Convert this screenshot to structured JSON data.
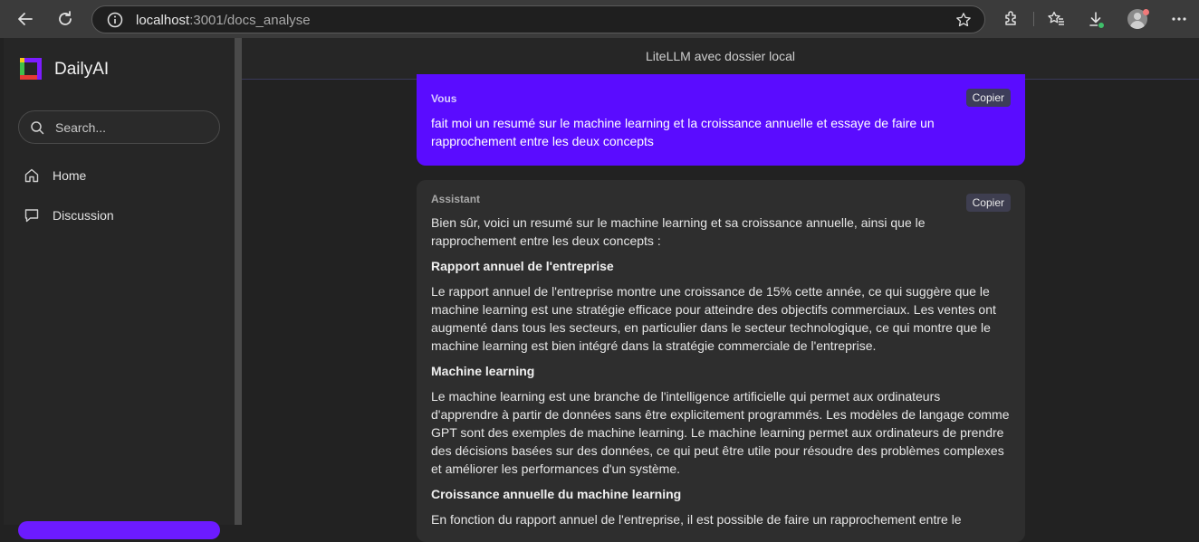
{
  "browser": {
    "url_host": "localhost",
    "url_path": ":3001/docs_analyse"
  },
  "sidebar": {
    "brand": "DailyAI",
    "search_placeholder": "Search...",
    "items": [
      {
        "label": "Home",
        "icon": "home-icon"
      },
      {
        "label": "Discussion",
        "icon": "chat-bubble-icon"
      }
    ]
  },
  "main": {
    "header_title": "LiteLLM avec dossier local",
    "messages": {
      "user": {
        "role": "Vous",
        "copy_label": "Copier",
        "text": "fait moi un resumé sur le machine learning et la croissance annuelle et essaye de faire un rapprochement entre les deux concepts"
      },
      "assistant": {
        "role": "Assistant",
        "copy_label": "Copier",
        "intro": "Bien sûr, voici un resumé sur le machine learning et sa croissance annuelle, ainsi que le rapprochement entre les deux concepts :",
        "section1_title": "Rapport annuel de l'entreprise",
        "section1_text": "Le rapport annuel de l'entreprise montre une croissance de 15% cette année, ce qui suggère que le machine learning est une stratégie efficace pour atteindre des objectifs commerciaux. Les ventes ont augmenté dans tous les secteurs, en particulier dans le secteur technologique, ce qui montre que le machine learning est bien intégré dans la stratégie commerciale de l'entreprise.",
        "section2_title": "Machine learning",
        "section2_text": "Le machine learning est une branche de l'intelligence artificielle qui permet aux ordinateurs d'apprendre à partir de données sans être explicitement programmés. Les modèles de langage comme GPT sont des exemples de machine learning. Le machine learning permet aux ordinateurs de prendre des décisions basées sur des données, ce qui peut être utile pour résoudre des problèmes complexes et améliorer les performances d'un système.",
        "section3_title": "Croissance annuelle du machine learning",
        "section3_text": "En fonction du rapport annuel de l'entreprise, il est possible de faire un rapprochement entre le"
      }
    }
  },
  "colors": {
    "accent": "#5a0cff",
    "sidebar_cta": "#6c1bff"
  }
}
